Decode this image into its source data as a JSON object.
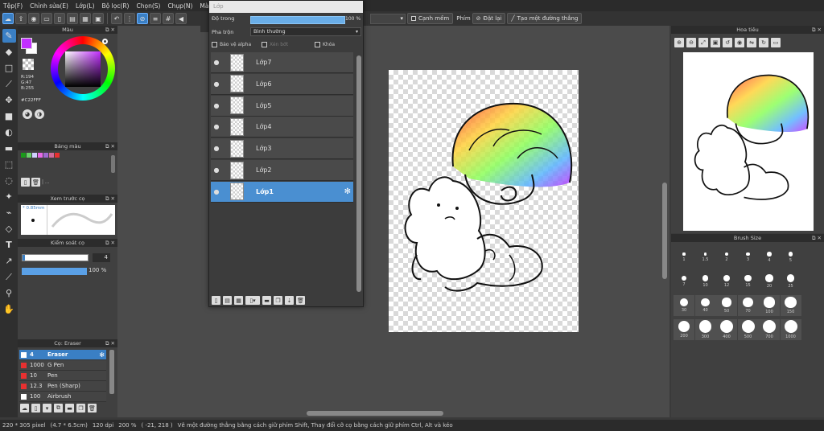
{
  "menu": [
    "Tệp(F)",
    "Chỉnh sửa(E)",
    "Lớp(L)",
    "Bộ lọc(R)",
    "Chọn(S)",
    "Chụp(N)",
    "Màu (C"
  ],
  "toolbar": {
    "anti_alias_label": "Cạnh mềm",
    "snap_label": "Phím",
    "snap_off_label": "Đặt lại",
    "line_label": "Tạo một đường thẳng"
  },
  "doc_tab": "1",
  "color_panel": {
    "title": "Màu",
    "fg_color": "#C22FFF",
    "rgb": [
      "R:194",
      "G:47",
      "B:255"
    ],
    "hex": "#C22FFF"
  },
  "palette_panel": {
    "title": "Bảng màu",
    "swatches": [
      "#1a9a1a",
      "#6ad06a",
      "#d0d0ff",
      "#e86ae8",
      "#a06ad0",
      "#d06a9a",
      "#e83030"
    ]
  },
  "preview_panel": {
    "title": "Xem trước cọ",
    "size": "0.85mm"
  },
  "control_panel": {
    "title": "Kiểm soát cọ",
    "size_value": "4",
    "opacity_value": "100 %",
    "opacity": 1.0
  },
  "brush_panel": {
    "title": "Cọ: Eraser",
    "brushes": [
      {
        "size": "4",
        "name": "Eraser",
        "color": "#ffffff",
        "active": true
      },
      {
        "size": "1000",
        "name": "G Pen",
        "color": "#e83030",
        "active": false
      },
      {
        "size": "10",
        "name": "Pen",
        "color": "#e83030",
        "active": false
      },
      {
        "size": "12.3",
        "name": "Pen (Sharp)",
        "color": "#e83030",
        "active": false
      },
      {
        "size": "100",
        "name": "Airbrush",
        "color": "#ffffff",
        "active": false
      }
    ]
  },
  "layer_panel": {
    "title": "Lớp",
    "opacity_label": "Độ trong",
    "opacity_value": "100 %",
    "opacity": 1.0,
    "blend_label": "Pha trộn",
    "blend_mode": "Bình thường",
    "protect_alpha": "Bảo vệ alpha",
    "clipping": "Xén bớt",
    "lock": "Khóa",
    "layers": [
      "Lớp7",
      "Lớp6",
      "Lớp5",
      "Lớp4",
      "Lớp3",
      "Lớp2",
      "Lớp1"
    ],
    "active_layer": "Lớp1"
  },
  "navigator": {
    "title": "Hoa tiêu"
  },
  "brush_size_panel": {
    "title": "Brush Size",
    "sizes": [
      "1",
      "1.5",
      "2",
      "3",
      "4",
      "5",
      "7",
      "10",
      "12",
      "15",
      "20",
      "25",
      "30",
      "40",
      "50",
      "70",
      "100",
      "150",
      "200",
      "300",
      "400",
      "500",
      "700",
      "1000"
    ]
  },
  "status": {
    "size": "220 * 305 pixel",
    "physical": "(4.7 * 6.5cm)",
    "dpi": "120 dpi",
    "zoom": "200 %",
    "coords": "( -21, 218 )",
    "hint": "Vẽ một đường thẳng bằng cách giữ phím Shift, Thay đổi cỡ cọ bằng cách giữ phím Ctrl, Alt và kéo"
  }
}
